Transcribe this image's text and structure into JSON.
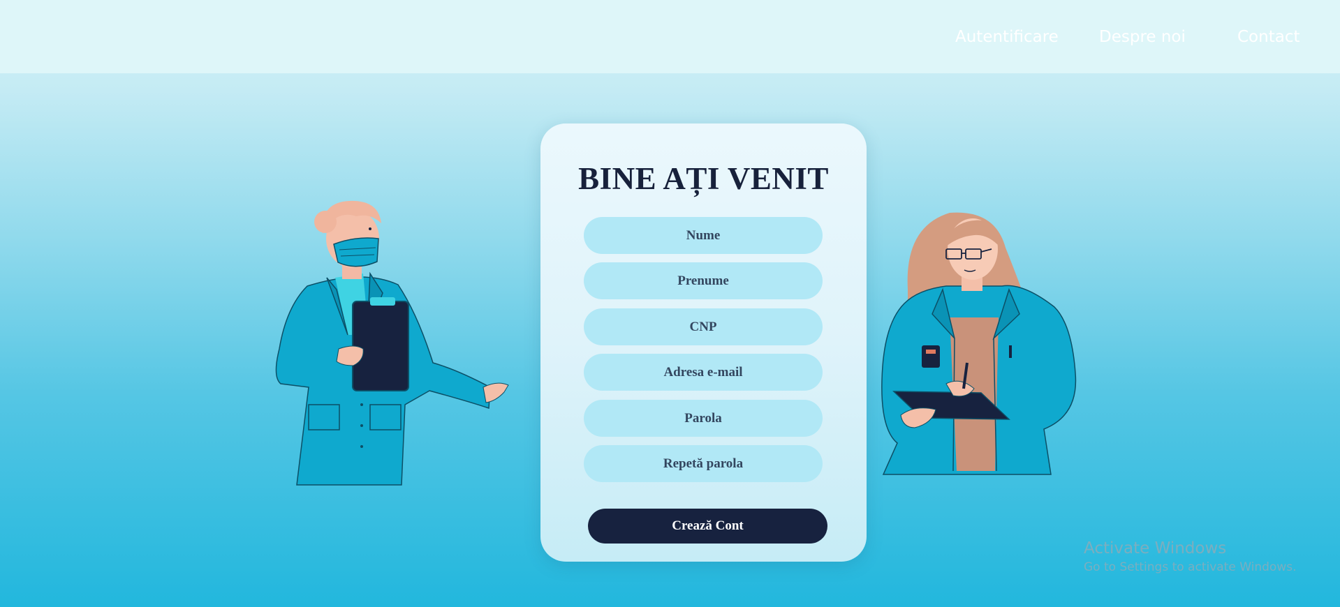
{
  "nav": {
    "links": [
      {
        "label": "Autentificare"
      },
      {
        "label": "Despre noi"
      },
      {
        "label": "Contact"
      }
    ]
  },
  "form": {
    "title": "BINE AȚI VENIT",
    "fields": [
      {
        "placeholder": "Nume",
        "value": ""
      },
      {
        "placeholder": "Prenume",
        "value": ""
      },
      {
        "placeholder": "CNP",
        "value": ""
      },
      {
        "placeholder": "Adresa e-mail",
        "value": ""
      },
      {
        "placeholder": "Parola",
        "value": ""
      },
      {
        "placeholder": "Repetă parola",
        "value": ""
      }
    ],
    "submit_label": "Crează Cont"
  },
  "illustrations": {
    "left": "doctor-with-clipboard-illustration",
    "right": "nurse-writing-illustration"
  },
  "watermark": {
    "title": "Activate Windows",
    "subtitle": "Go to Settings to activate Windows."
  },
  "colors": {
    "primary_dark": "#17223f",
    "field_bg": "#b1e8f6",
    "coat": "#0fa9ce",
    "header_bg": "#def6f9"
  }
}
